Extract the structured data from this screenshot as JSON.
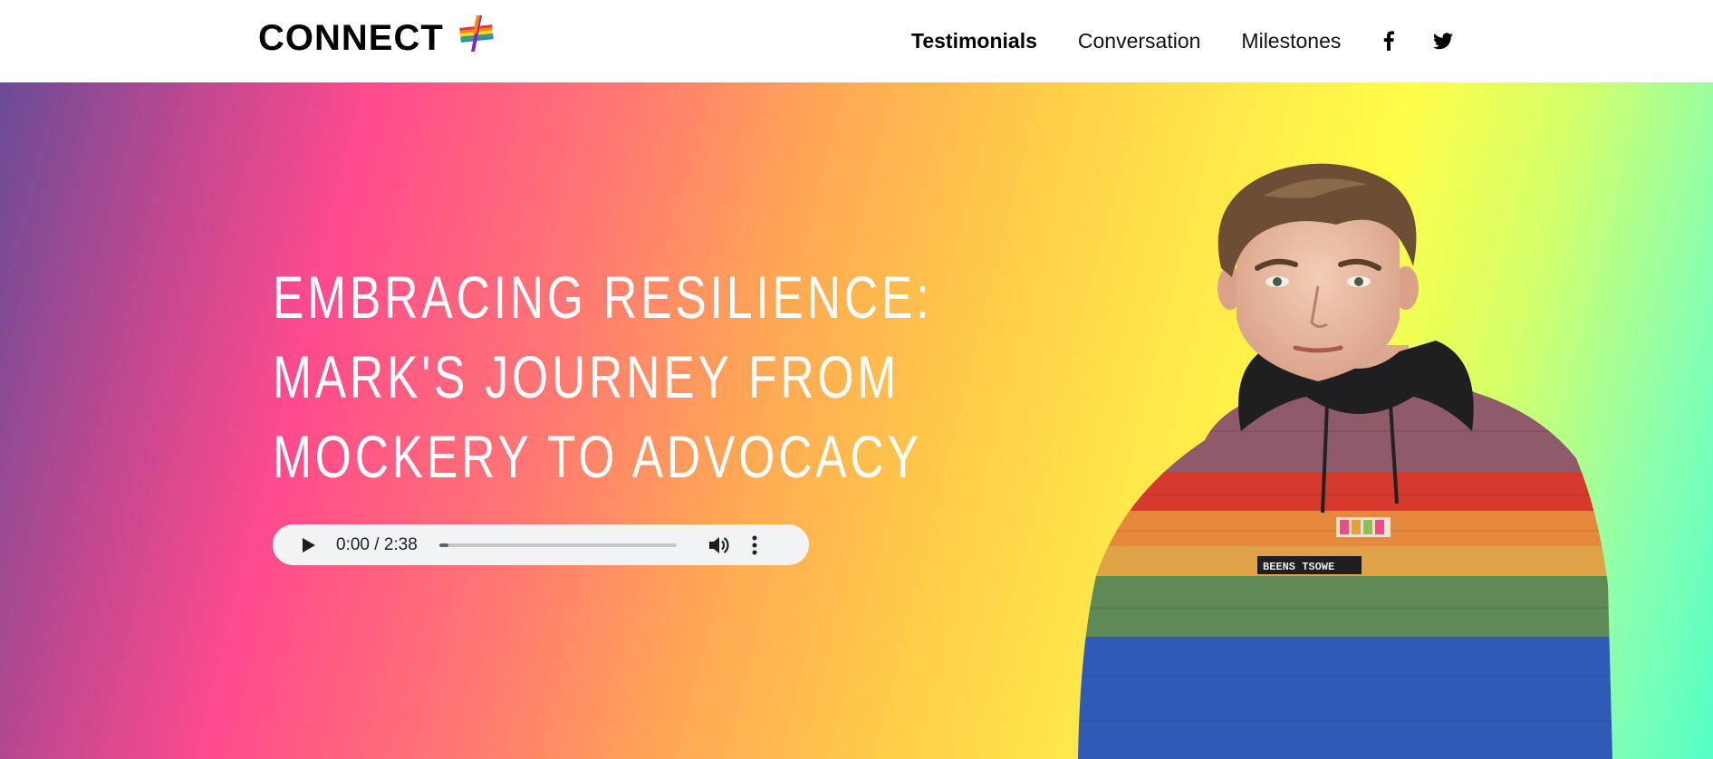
{
  "header": {
    "logo_text": "CONNECT",
    "logo_icon": "rainbow-plus-icon",
    "nav": [
      {
        "label": "Testimonials",
        "active": true
      },
      {
        "label": "Conversation",
        "active": false
      },
      {
        "label": "Milestones",
        "active": false
      }
    ],
    "social": [
      "facebook-icon",
      "twitter-icon"
    ]
  },
  "hero": {
    "title_lines": [
      "EMBRACING RESILIENCE:",
      "MARK'S JOURNEY FROM",
      "MOCKERY TO ADVOCACY"
    ],
    "gradient_colors": [
      "#6a4b97",
      "#ff4a8d",
      "#ffa655",
      "#fffd48",
      "#55ffc8"
    ]
  },
  "audio_player": {
    "time": "0:00 / 2:38",
    "progress_fraction": 0.04,
    "icons": [
      "play-icon",
      "volume-icon",
      "more-vert-icon"
    ]
  },
  "portrait": {
    "sweater_patch_text": "BEENS TSOWE"
  }
}
